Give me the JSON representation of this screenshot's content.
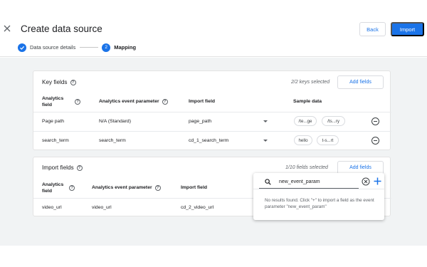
{
  "header": {
    "title": "Create data source",
    "back_label": "Back",
    "import_label": "Import",
    "steps": [
      {
        "label": "Data source details",
        "status": "done"
      },
      {
        "label": "Mapping",
        "number": "2",
        "status": "active"
      }
    ]
  },
  "key_fields": {
    "title": "Key fields",
    "selected": "2/2 keys selected",
    "add_label": "Add fields",
    "columns": [
      "Analytics field",
      "Analytics event parameter",
      "Import field",
      "Sample data"
    ],
    "rows": [
      {
        "analytics_field": "Page path",
        "event_param": "N/A (Standard)",
        "import_field": "page_path",
        "samples": [
          "/te...ge",
          "/ts...ry"
        ]
      },
      {
        "analytics_field": "search_term",
        "event_param": "search_term",
        "import_field": "cd_1_search_term",
        "samples": [
          "hello",
          "t-s...rt"
        ]
      }
    ]
  },
  "import_fields": {
    "title": "Import fields",
    "selected": "1/10 fields selected",
    "add_label": "Add fields",
    "columns": [
      "Analytics field",
      "Analytics event parameter",
      "Import field"
    ],
    "rows": [
      {
        "analytics_field": "video_url",
        "event_param": "video_url",
        "import_field": "cd_2_video_url"
      }
    ]
  },
  "popup": {
    "search_value": "new_event_param",
    "message": "No results found. Click \"+\" to import a field as the event parameter \"new_event_param\""
  },
  "colors": {
    "accent": "#1a73e8",
    "background": "#f1f3f4"
  }
}
